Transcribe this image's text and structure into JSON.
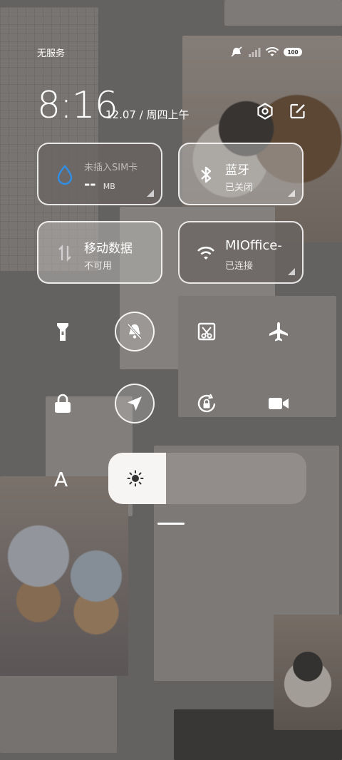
{
  "status_bar": {
    "carrier": "无服务",
    "battery": "100"
  },
  "header": {
    "time": "8:16",
    "date": "12.07 / 周四上午"
  },
  "tiles": {
    "data_usage": {
      "title": "未插入SIM卡",
      "value": "--",
      "unit": "MB"
    },
    "bluetooth": {
      "title": "蓝牙",
      "status": "已关闭"
    },
    "mobile_data": {
      "title": "移动数据",
      "status": "不可用"
    },
    "wifi": {
      "title": "MIOffice-",
      "status": "已连接"
    }
  },
  "toggles": [
    {
      "icon": "flashlight-icon",
      "active": false
    },
    {
      "icon": "mute-bell-icon",
      "active": true
    },
    {
      "icon": "screenshot-icon",
      "active": false
    },
    {
      "icon": "airplane-icon",
      "active": false
    },
    {
      "icon": "lock-icon",
      "active": false
    },
    {
      "icon": "location-icon",
      "active": true
    },
    {
      "icon": "rotation-lock-icon",
      "active": false
    },
    {
      "icon": "screen-record-icon",
      "active": false
    }
  ],
  "brightness": {
    "auto_label": "A",
    "level": 0.29
  },
  "colors": {
    "accent_blue": "#2f8fe6",
    "tile_border": "#ffffff"
  }
}
